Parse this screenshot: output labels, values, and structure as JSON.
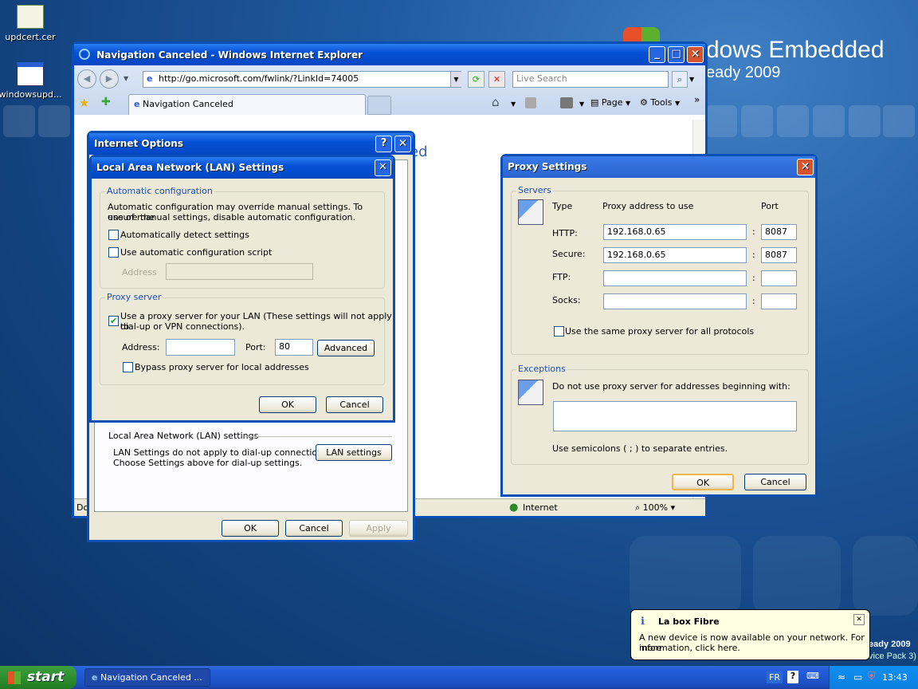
{
  "desktop": {
    "icons": [
      {
        "label": "updcert.cer"
      },
      {
        "label": "windowsupd..."
      }
    ],
    "brand_line1": "dows",
    "brand_embedded": "Embedded",
    "brand_line2": "eady 2009",
    "brand_corner1": "eady 2009",
    "brand_corner2": "vice Pack 3)"
  },
  "ie": {
    "title": "Navigation Canceled - Windows Internet Explorer",
    "url": "http://go.microsoft.com/fwlink/?LinkId=74005",
    "search_placeholder": "Live Search",
    "tab": "Navigation Canceled",
    "page_label": "Page",
    "tools_label": "Tools",
    "content_text": "led",
    "status_left": "Don",
    "status_zone": "Internet",
    "zoom": "100%"
  },
  "inetopt": {
    "title": "Internet Options",
    "lan_section": "Local Area Network (LAN) settings",
    "lan_desc1": "LAN Settings do not apply to dial-up connections.",
    "lan_desc2": "Choose Settings above for dial-up settings.",
    "lan_btn": "LAN settings",
    "ok": "OK",
    "cancel": "Cancel",
    "apply": "Apply"
  },
  "lan": {
    "title": "Local Area Network (LAN) Settings",
    "auto_group": "Automatic configuration",
    "auto_desc1": "Automatic configuration may override manual settings.  To ensure the",
    "auto_desc2": "use of manual settings, disable automatic configuration.",
    "auto_detect": "Automatically detect settings",
    "auto_script": "Use automatic configuration script",
    "address_label": "Address",
    "proxy_group": "Proxy server",
    "use_proxy1": "Use a proxy server for your LAN (These settings will not apply to",
    "use_proxy2": "dial-up or VPN connections).",
    "address2_label": "Address:",
    "port_label": "Port:",
    "port_value": "80",
    "advanced": "Advanced",
    "bypass": "Bypass proxy server for local addresses",
    "ok": "OK",
    "cancel": "Cancel",
    "use_proxy_checked": true
  },
  "proxy": {
    "title": "Proxy Settings",
    "servers_group": "Servers",
    "col_type": "Type",
    "col_addr": "Proxy address to use",
    "col_port": "Port",
    "rows": [
      {
        "type": "HTTP:",
        "addr": "192.168.0.65",
        "port": "8087"
      },
      {
        "type": "Secure:",
        "addr": "192.168.0.65",
        "port": "8087"
      },
      {
        "type": "FTP:",
        "addr": "",
        "port": ""
      },
      {
        "type": "Socks:",
        "addr": "",
        "port": ""
      }
    ],
    "colon": ":",
    "same_proxy": "Use the same proxy server for all protocols",
    "exceptions_group": "Exceptions",
    "exc_desc": "Do not use proxy server for addresses beginning with:",
    "exc_hint": "Use semicolons ( ; ) to separate entries.",
    "ok": "OK",
    "cancel": "Cancel"
  },
  "taskbar": {
    "start": "start",
    "task": "Navigation Canceled ...",
    "lang": "FR",
    "time": "13:43"
  },
  "balloon": {
    "title": "La box Fibre",
    "text1": "A new device is now available on your network. For more",
    "text2": "information, click here."
  },
  "colors": {
    "titlebar": "#0551d6",
    "close": "#d8522b",
    "start": "#2d8f2d",
    "dialog": "#ece9d8"
  }
}
